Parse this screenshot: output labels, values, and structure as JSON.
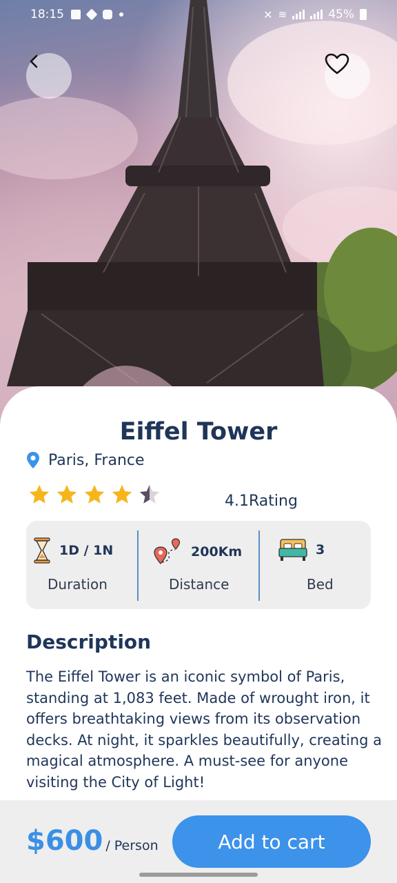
{
  "status_bar": {
    "time": "18:15",
    "battery": "45%"
  },
  "hero": {
    "back_icon": "chevron-left-icon",
    "favorite_icon": "heart-outline-icon"
  },
  "place": {
    "title": "Eiffel Tower",
    "location": "Paris, France",
    "rating": 4.1,
    "rating_text": "4.1Rating",
    "stars": 5
  },
  "info": [
    {
      "icon": "hourglass-icon",
      "value": "1D / 1N",
      "label": "Duration"
    },
    {
      "icon": "map-route-icon",
      "value": "200Km",
      "label": "Distance"
    },
    {
      "icon": "bed-icon",
      "value": "3",
      "label": "Bed"
    }
  ],
  "description": {
    "heading": "Description",
    "text": "The Eiffel Tower is an iconic symbol of Paris, standing at 1,083 feet. Made of wrought iron, it offers breathtaking views from its observation decks. At night, it sparkles beautifully, creating a magical atmosphere. A must-see for anyone visiting the City of Light!"
  },
  "footer": {
    "price": "$600",
    "price_unit": "/ Person",
    "cart_label": "Add to cart"
  },
  "colors": {
    "accent": "#3d92ea",
    "title": "#1f3559",
    "star": "#f6b51a",
    "panel": "#eeeeee"
  }
}
